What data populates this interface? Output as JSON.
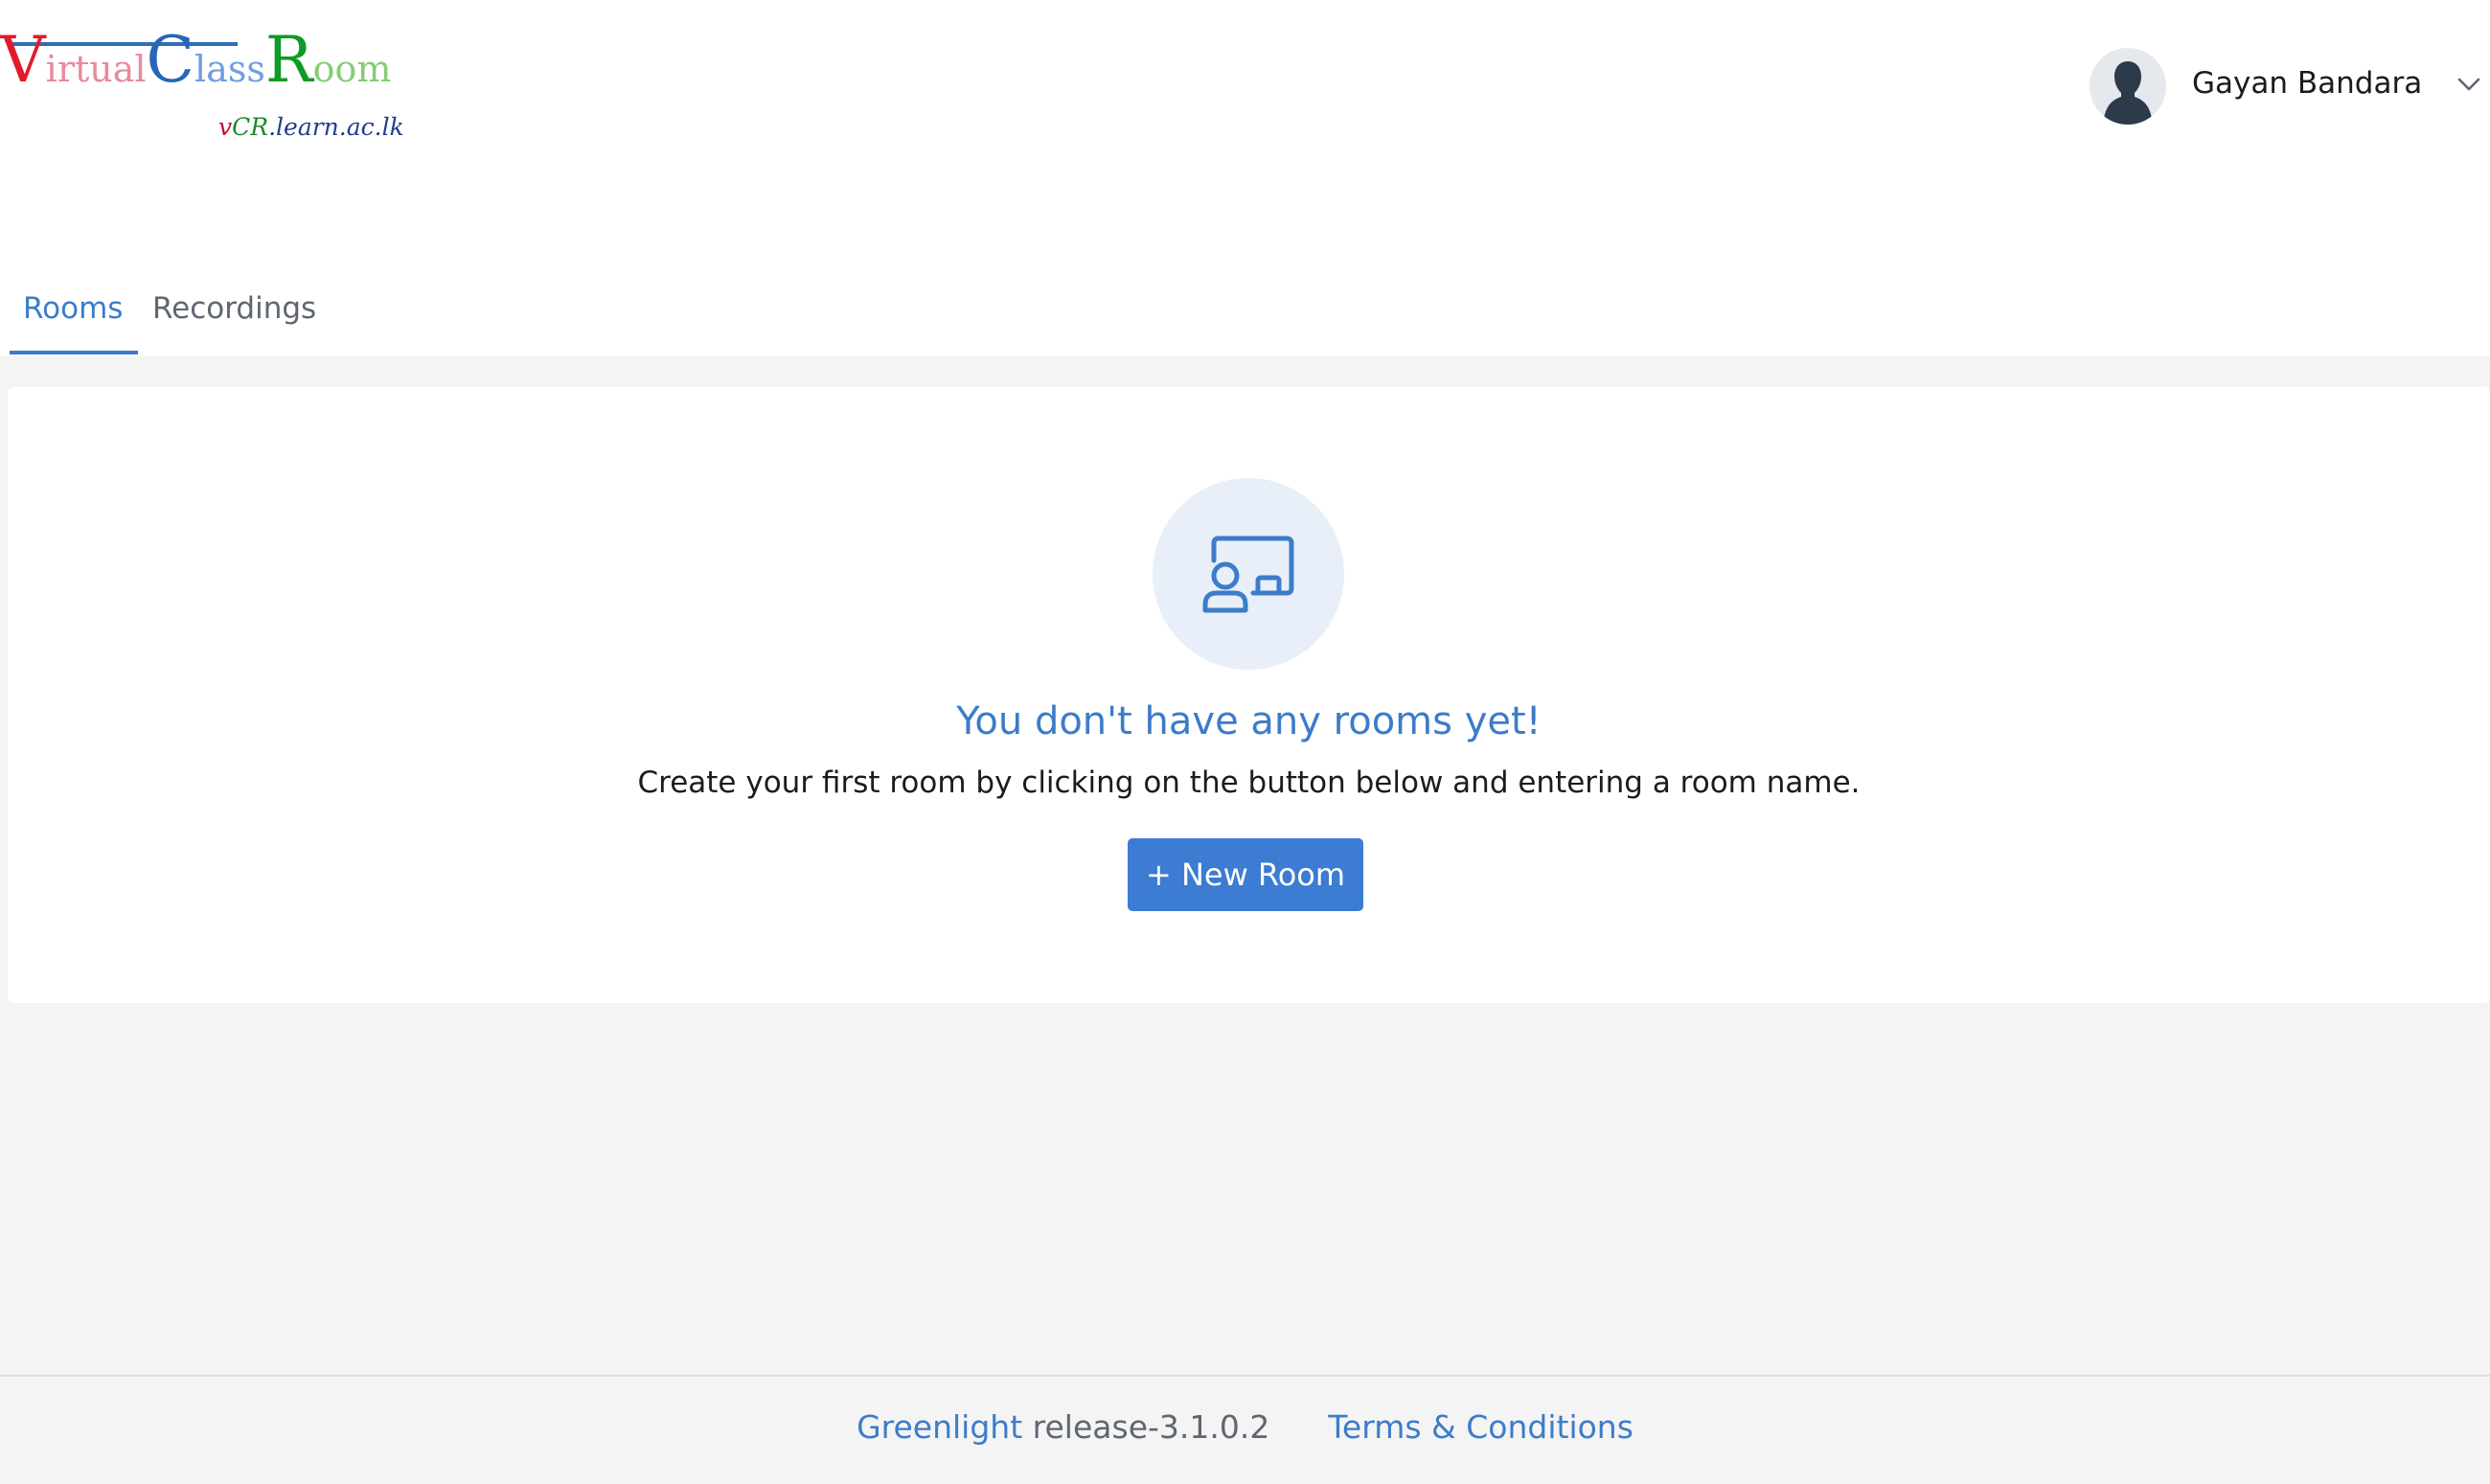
{
  "brand": {
    "logo_title_letters": [
      {
        "t": "V",
        "color": "#e01b2a",
        "big": true
      },
      {
        "t": "irtual",
        "color": "#e98a9a",
        "big": false
      },
      {
        "t": "C",
        "color": "#2566b8",
        "big": true
      },
      {
        "t": "lass",
        "color": "#6f9ee0",
        "big": false
      },
      {
        "t": "R",
        "color": "#0e9a24",
        "big": true
      },
      {
        "t": "oom",
        "color": "#86cc74",
        "big": false
      }
    ],
    "logo_sub_v": "v",
    "logo_sub_cr": "CR",
    "logo_sub_rest": ".learn.ac.lk"
  },
  "header": {
    "user_name": "Gayan Bandara",
    "user_menu_icon": "chevron-down-icon",
    "avatar_icon": "user-silhouette-icon"
  },
  "tabs": [
    {
      "label": "Rooms",
      "active": true
    },
    {
      "label": "Recordings",
      "active": false
    }
  ],
  "empty_state": {
    "icon": "presentation-board-icon",
    "title": "You don't have any rooms yet!",
    "description": "Create your first room by clicking on the button below and entering a room name.",
    "button_label": "+ New Room"
  },
  "footer": {
    "product_link": "Greenlight",
    "release": "release-3.1.0.2",
    "terms_link": "Terms & Conditions"
  },
  "colors": {
    "accent": "#3c7cc9",
    "button": "#3c7cd2",
    "page_bg": "#f4f4f4",
    "icon_circle": "#e8eff8"
  }
}
